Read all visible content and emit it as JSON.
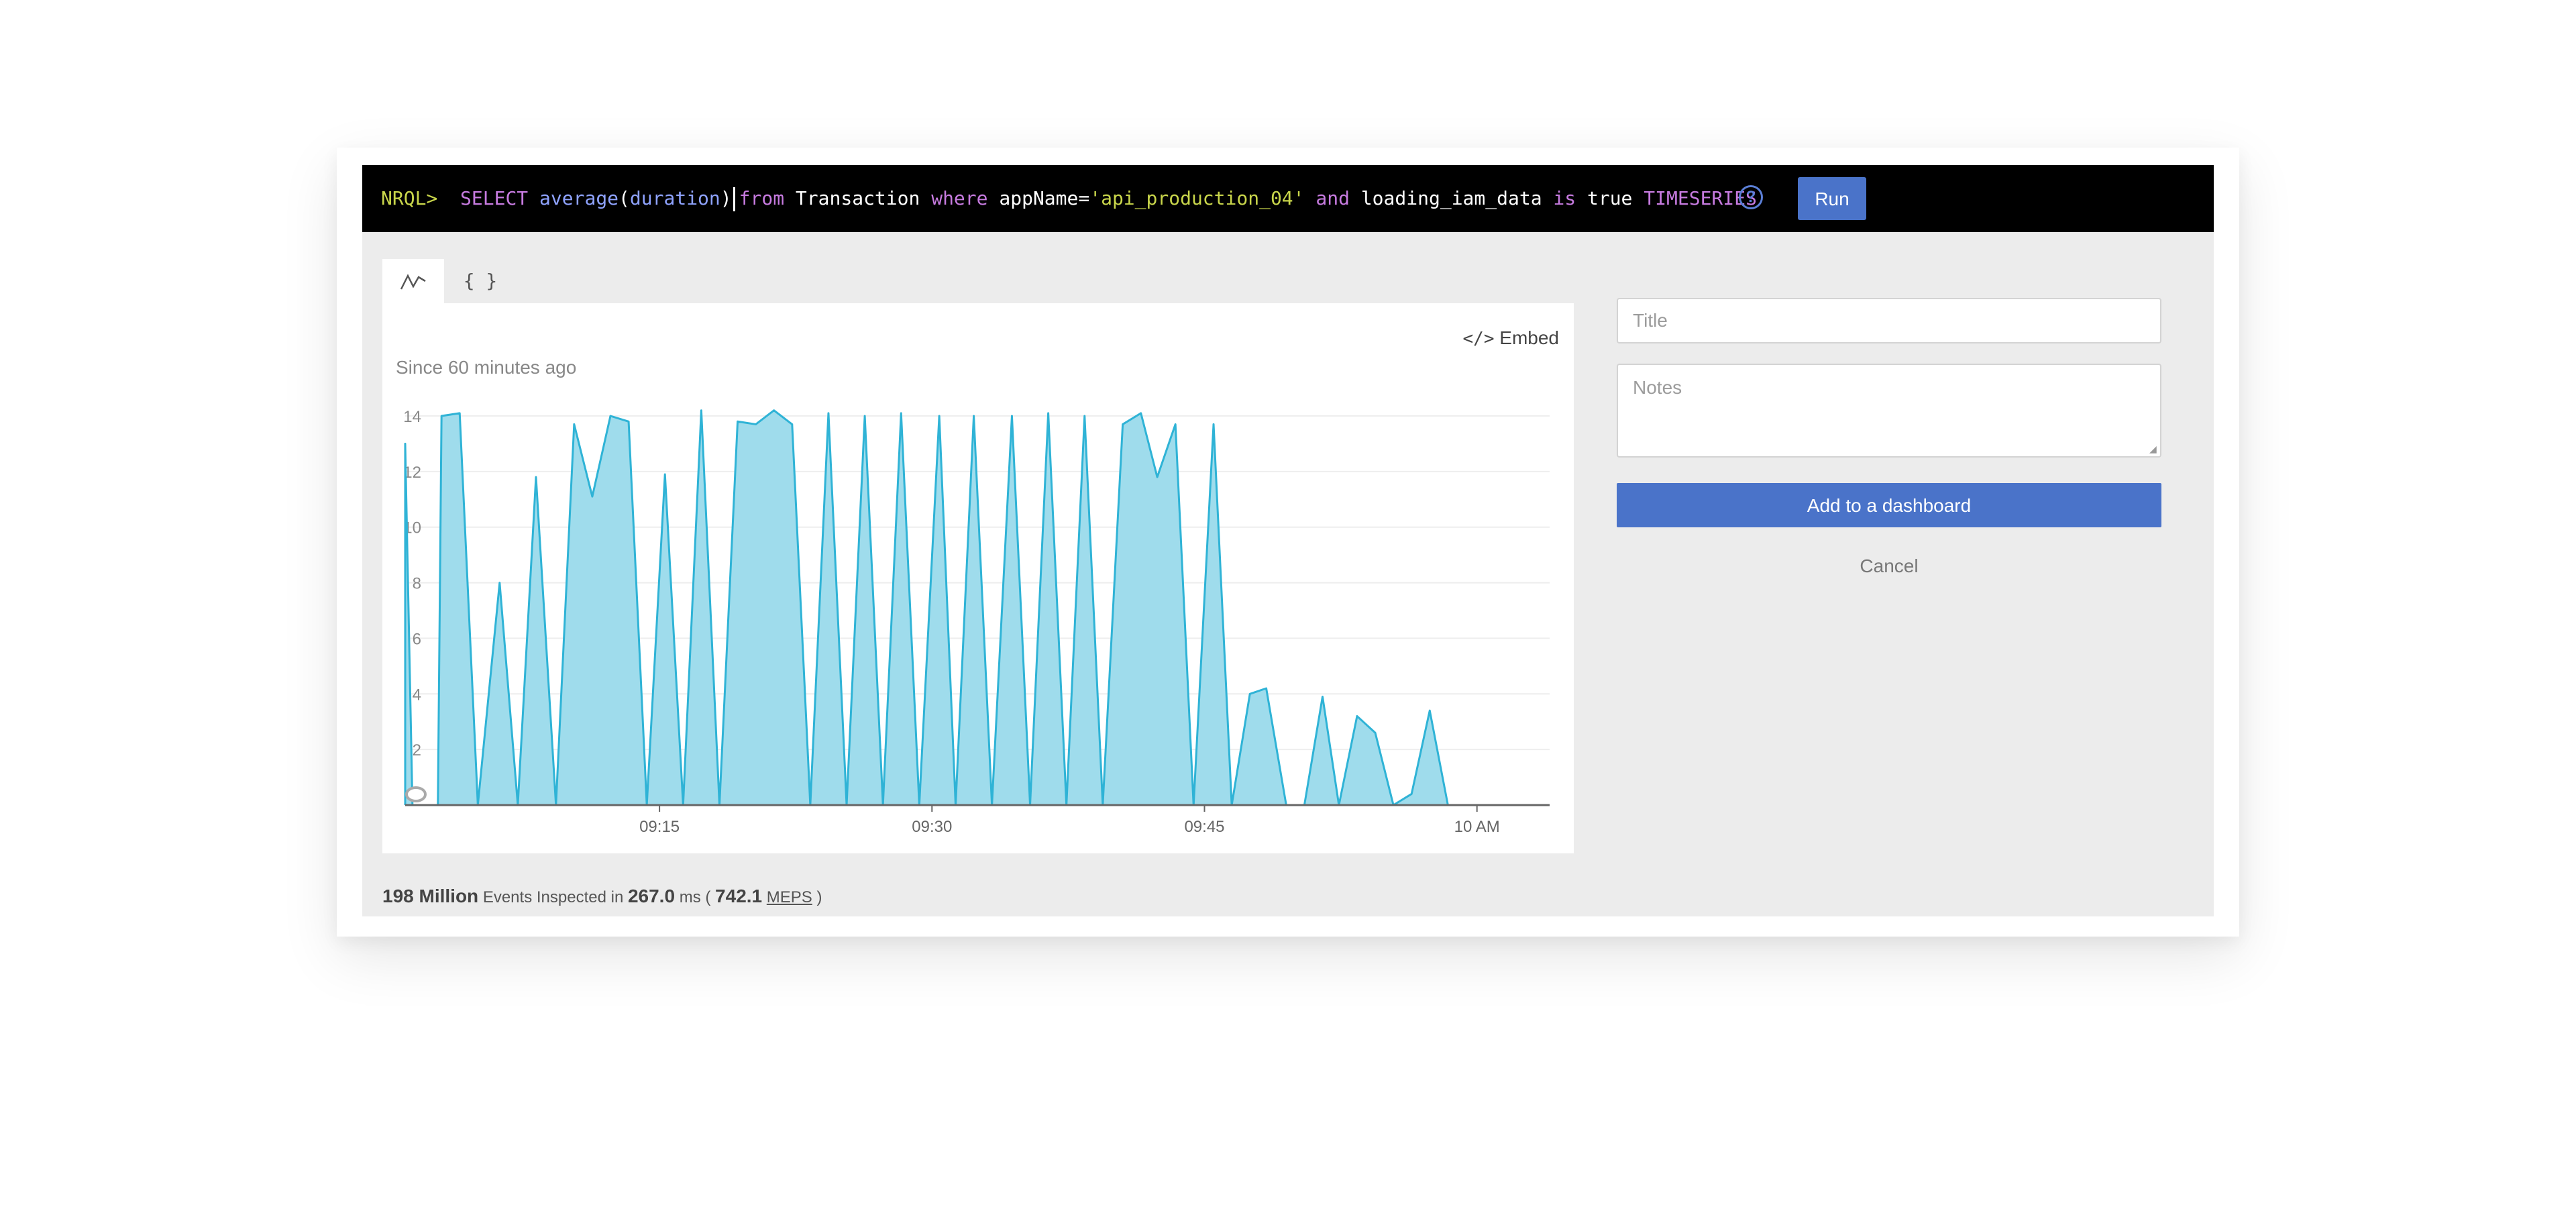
{
  "query": {
    "prompt": "NRQL>",
    "tokens": [
      {
        "text": "SELECT ",
        "kind": "kw"
      },
      {
        "text": "average",
        "kind": "fn"
      },
      {
        "text": "(",
        "kind": "plain"
      },
      {
        "text": "duration",
        "kind": "fn"
      },
      {
        "text": ")",
        "kind": "plain"
      },
      {
        "text": "from ",
        "kind": "kw"
      },
      {
        "text": "Transaction ",
        "kind": "plain"
      },
      {
        "text": "where ",
        "kind": "kw"
      },
      {
        "text": "appName=",
        "kind": "plain"
      },
      {
        "text": "'api_production_04' ",
        "kind": "str"
      },
      {
        "text": "and ",
        "kind": "kw"
      },
      {
        "text": "loading_iam_data ",
        "kind": "plain"
      },
      {
        "text": "is ",
        "kind": "kw"
      },
      {
        "text": "true ",
        "kind": "plain"
      },
      {
        "text": "TIMESERIES",
        "kind": "kw"
      }
    ],
    "run_label": "Run",
    "help_icon": "help-circle-icon"
  },
  "tabs": {
    "chart_icon": "line-chart-icon",
    "json_label": "{ }"
  },
  "chart_panel": {
    "embed_label": "Embed",
    "embed_icon": "code-icon",
    "since_label": "Since 60 minutes ago"
  },
  "stats": {
    "events": "198 Million",
    "events_text": "Events Inspected in",
    "duration": "267.0",
    "duration_unit": "ms (",
    "rate": "742.1",
    "rate_unit": "MEPS",
    "close": ")"
  },
  "sidebar": {
    "title_placeholder": "Title",
    "notes_placeholder": "Notes",
    "add_label": "Add to a dashboard",
    "cancel_label": "Cancel"
  },
  "colors": {
    "accent": "#4a73c9",
    "area_fill": "#9fdcec",
    "area_stroke": "#2fb3d6"
  },
  "chart_data": {
    "type": "area",
    "xlabel": "",
    "ylabel": "",
    "ylim": [
      0,
      14
    ],
    "yticks": [
      2,
      4,
      6,
      8,
      10,
      12,
      14
    ],
    "xticks": [
      {
        "label": "09:15",
        "t": 14
      },
      {
        "label": "09:30",
        "t": 29
      },
      {
        "label": "09:45",
        "t": 44
      },
      {
        "label": "10 AM",
        "t": 59
      }
    ],
    "xlim": [
      0,
      63
    ],
    "grid": true,
    "series": [
      {
        "points": [
          [
            0,
            0
          ],
          [
            0,
            13
          ],
          [
            0.4,
            0
          ],
          [
            1.8,
            0
          ],
          [
            2,
            14
          ],
          [
            3,
            14.1
          ],
          [
            4,
            0
          ],
          [
            5.2,
            8
          ],
          [
            6.2,
            0
          ],
          [
            7.2,
            11.8
          ],
          [
            8.3,
            0
          ],
          [
            9.3,
            13.7
          ],
          [
            10.3,
            11.1
          ],
          [
            11.3,
            14
          ],
          [
            12.3,
            13.8
          ],
          [
            13.3,
            0
          ],
          [
            14.3,
            11.9
          ],
          [
            15.3,
            0
          ],
          [
            16.3,
            14.2
          ],
          [
            17.3,
            0
          ],
          [
            18.3,
            13.8
          ],
          [
            19.3,
            13.7
          ],
          [
            20.3,
            14.2
          ],
          [
            21.3,
            13.7
          ],
          [
            22.3,
            0
          ],
          [
            23.3,
            14.1
          ],
          [
            24.3,
            0
          ],
          [
            25.3,
            14
          ],
          [
            26.3,
            0
          ],
          [
            27.3,
            14.1
          ],
          [
            28.3,
            0
          ],
          [
            29.4,
            14
          ],
          [
            30.3,
            0
          ],
          [
            31.3,
            14
          ],
          [
            32.3,
            0
          ],
          [
            33.4,
            14
          ],
          [
            34.4,
            0
          ],
          [
            35.4,
            14.1
          ],
          [
            36.4,
            0
          ],
          [
            37.4,
            14
          ],
          [
            38.4,
            0
          ],
          [
            39.5,
            13.7
          ],
          [
            40.5,
            14.1
          ],
          [
            41.4,
            11.8
          ],
          [
            42.4,
            13.7
          ],
          [
            43.4,
            0
          ],
          [
            44.5,
            13.7
          ],
          [
            45.5,
            0
          ],
          [
            46.5,
            4
          ],
          [
            47.4,
            4.2
          ],
          [
            48.5,
            0
          ],
          [
            49.5,
            0
          ],
          [
            50.5,
            3.9
          ],
          [
            51.4,
            0
          ],
          [
            52.4,
            3.2
          ],
          [
            53.4,
            2.6
          ],
          [
            54.4,
            0
          ],
          [
            55.4,
            0.4
          ],
          [
            56.4,
            3.4
          ],
          [
            57.4,
            0
          ]
        ]
      }
    ]
  }
}
